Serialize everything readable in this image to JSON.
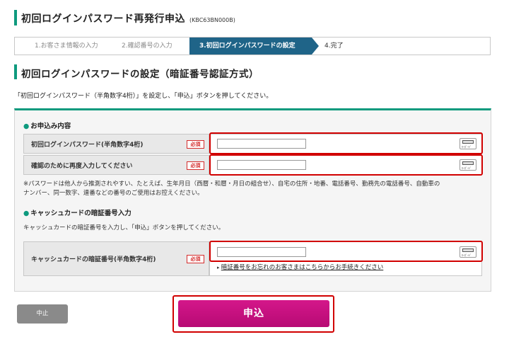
{
  "header": {
    "title": "初回ログインパスワード再発行申込",
    "code": "(KBC63BN000B)"
  },
  "steps": [
    {
      "label": "1.お客さま情報の入力"
    },
    {
      "label": "2.確認番号の入力"
    },
    {
      "label": "3.初回ログインパスワードの設定"
    },
    {
      "label": "4.完了"
    }
  ],
  "section": {
    "title": "初回ログインパスワードの設定（暗証番号認証方式）",
    "intro": "「初回ログインパスワード（半角数字4桁）」を設定し、「申込」ボタンを押してください。"
  },
  "form": {
    "group1": {
      "title": "お申込み内容",
      "password_label": "初回ログインパスワード(半角数字4桁)",
      "confirm_label": "確認のために再度入力してください",
      "required": "必須",
      "note_line1": "※パスワードは他人から推測されやすい、たとえば、生年月日（西暦・和暦・月日の組合せ）、自宅の住所・地番、電話番号、勤務先の電話番号、自動車の",
      "note_line2": "ナンバー、同一数字、連番などの番号のご使用はお控えください。"
    },
    "group2": {
      "title": "キャッシュカードの暗証番号入力",
      "desc": "キャッシュカードの暗証番号を入力し、「申込」ボタンを押してください。",
      "pin_label": "キャッシュカードの暗証番号(半角数字4桁)",
      "required": "必須",
      "forgot_link": "暗証番号をお忘れのお客さまはこちらからお手続きください"
    },
    "keyboard_label": "ｷｰﾎﾞｰﾄﾞ"
  },
  "buttons": {
    "cancel": "中止",
    "submit": "申込"
  },
  "colors": {
    "accent": "#0e9a7e",
    "step_active": "#1f6488",
    "submit": "#c4117f",
    "highlight": "#d10000"
  }
}
